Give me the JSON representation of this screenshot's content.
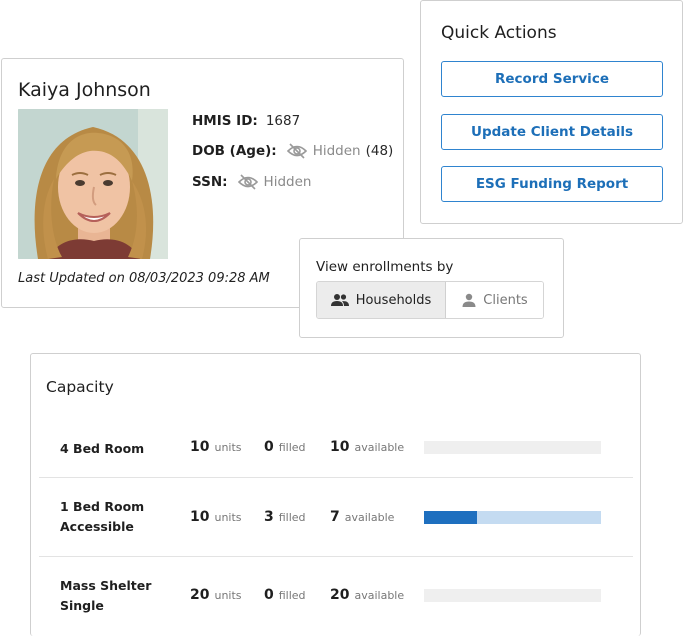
{
  "client": {
    "name": "Kaiya Johnson",
    "hmis_label": "HMIS ID:",
    "hmis_value": "1687",
    "dob_label": "DOB (Age):",
    "dob_hidden": "Hidden",
    "dob_age": "(48)",
    "ssn_label": "SSN:",
    "ssn_hidden": "Hidden",
    "last_updated": "Last Updated on 08/03/2023 09:28 AM",
    "photo_icon": "client-photo"
  },
  "quick_actions": {
    "title": "Quick Actions",
    "buttons": [
      "Record Service",
      "Update Client Details",
      "ESG Funding Report"
    ]
  },
  "view_enrollments": {
    "title": "View enrollments by",
    "options": [
      {
        "label": "Households",
        "icon": "people-icon",
        "active": true
      },
      {
        "label": "Clients",
        "icon": "person-icon",
        "active": false
      }
    ]
  },
  "capacity": {
    "title": "Capacity",
    "rows": [
      {
        "name": "4 Bed Room",
        "units": "10",
        "units_label": "units",
        "filled": "0",
        "filled_label": "filled",
        "available": "10",
        "available_label": "available",
        "fill_fraction": 0.0
      },
      {
        "name": "1 Bed Room Accessible",
        "units": "10",
        "units_label": "units",
        "filled": "3",
        "filled_label": "filled",
        "available": "7",
        "available_label": "available",
        "fill_fraction": 0.3
      },
      {
        "name": "Mass Shelter Single",
        "units": "20",
        "units_label": "units",
        "filled": "0",
        "filled_label": "filled",
        "available": "20",
        "available_label": "available",
        "fill_fraction": 0.0
      }
    ]
  },
  "colors": {
    "accent": "#1e6fbf",
    "accent_light": "#c4dbf1",
    "button_border": "#2f84cf",
    "muted_text": "#8a8a8a"
  }
}
